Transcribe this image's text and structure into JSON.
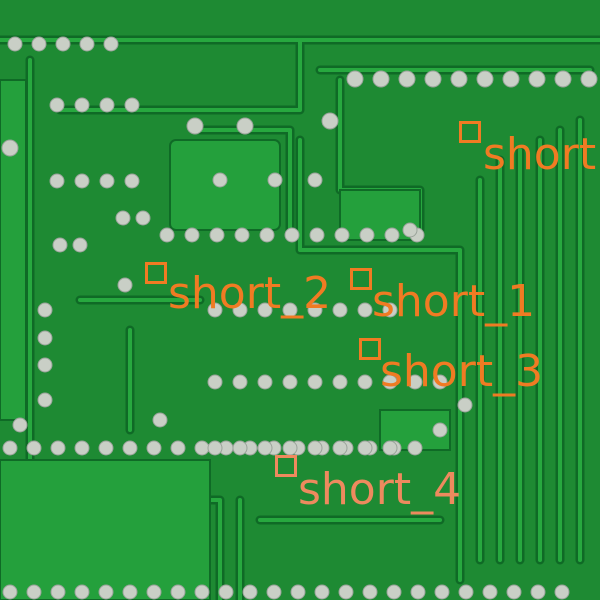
{
  "scene": {
    "description_colors": {
      "board": "#1e8a33",
      "trace": "#27a83f",
      "trace_edge": "#0f6a26",
      "pad": "#c9cfc6",
      "annotation": "#f07b23",
      "annotation_alt": "#ee8a5e"
    }
  },
  "detections": [
    {
      "label": "short",
      "color": "#f07b23"
    },
    {
      "label": "short_2",
      "color": "#f07b23"
    },
    {
      "label": "short_1",
      "color": "#f07b23"
    },
    {
      "label": "short_3",
      "color": "#f07b23"
    },
    {
      "label": "short_4",
      "color": "#ee8a5e"
    }
  ]
}
